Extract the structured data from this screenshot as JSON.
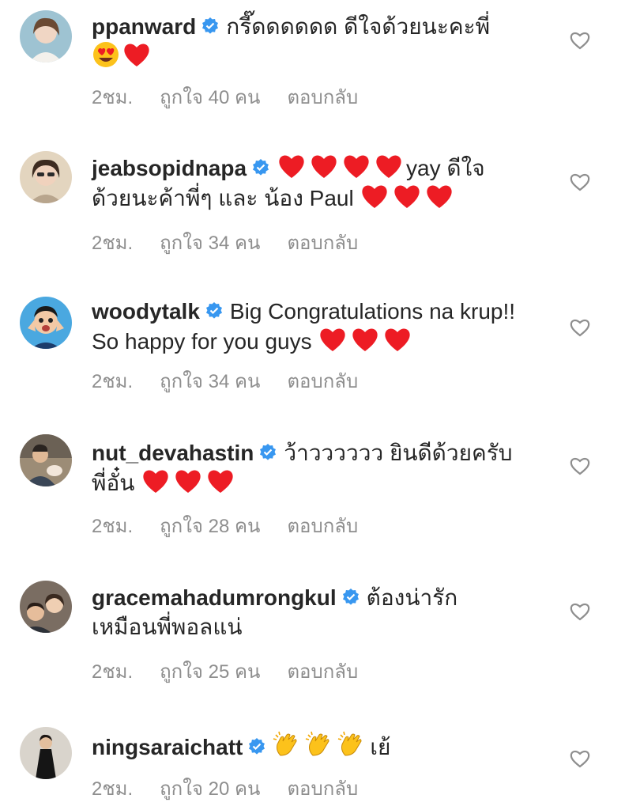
{
  "comments": [
    {
      "username": "ppanward",
      "avatar_color": "#7fb3c8",
      "text": "กรี๊ดดดดดด ดีใจด้วยนะคะพี่",
      "emojis_after": [
        "smiling-face-heart-eyes",
        "red-heart"
      ],
      "time": "2ชม.",
      "likes": "ถูกใจ 40 คน",
      "reply": "ตอบกลับ"
    },
    {
      "username": "jeabsopidnapa",
      "avatar_color": "#d9c8a8",
      "text_before_emoji": "",
      "hearts_before": 4,
      "text": "yay ดีใจด้วยนะค้าพี่ๆ และ น้อง Paul",
      "hearts_after": 3,
      "time": "2ชม.",
      "likes": "ถูกใจ 34 คน",
      "reply": "ตอบกลับ"
    },
    {
      "username": "woodytalk",
      "avatar_color": "#4aa8e0",
      "text": "Big Congratulations na krup!! So happy for you guys",
      "hearts_after": 3,
      "time": "2ชม.",
      "likes": "ถูกใจ 34 คน",
      "reply": "ตอบกลับ"
    },
    {
      "username": "nut_devahastin",
      "avatar_color": "#8a7a66",
      "text": "ว้าวววววว ยินดีด้วยครับพี่อั๋น",
      "hearts_after": 3,
      "time": "2ชม.",
      "likes": "ถูกใจ 28 คน",
      "reply": "ตอบกลับ"
    },
    {
      "username": "gracemahadumrongkul",
      "avatar_color": "#6e6258",
      "text": "ต้องน่ารักเหมือนพี่พอลแน่",
      "time": "2ชม.",
      "likes": "ถูกใจ 25 คน",
      "reply": "ตอบกลับ"
    },
    {
      "username": "ningsaraichatt",
      "avatar_color": "#c9c4bc",
      "clap_count": 3,
      "text": "เย้",
      "time": "2ชม.",
      "likes": "ถูกใจ 20 คน",
      "reply": "ตอบกลับ"
    }
  ],
  "colors": {
    "verified": "#3897f0",
    "heart": "#ed1c24",
    "meta": "#8e8e8e",
    "text": "#262626"
  },
  "icons": {
    "verified": "verified-badge-icon",
    "like": "heart-outline-icon"
  }
}
